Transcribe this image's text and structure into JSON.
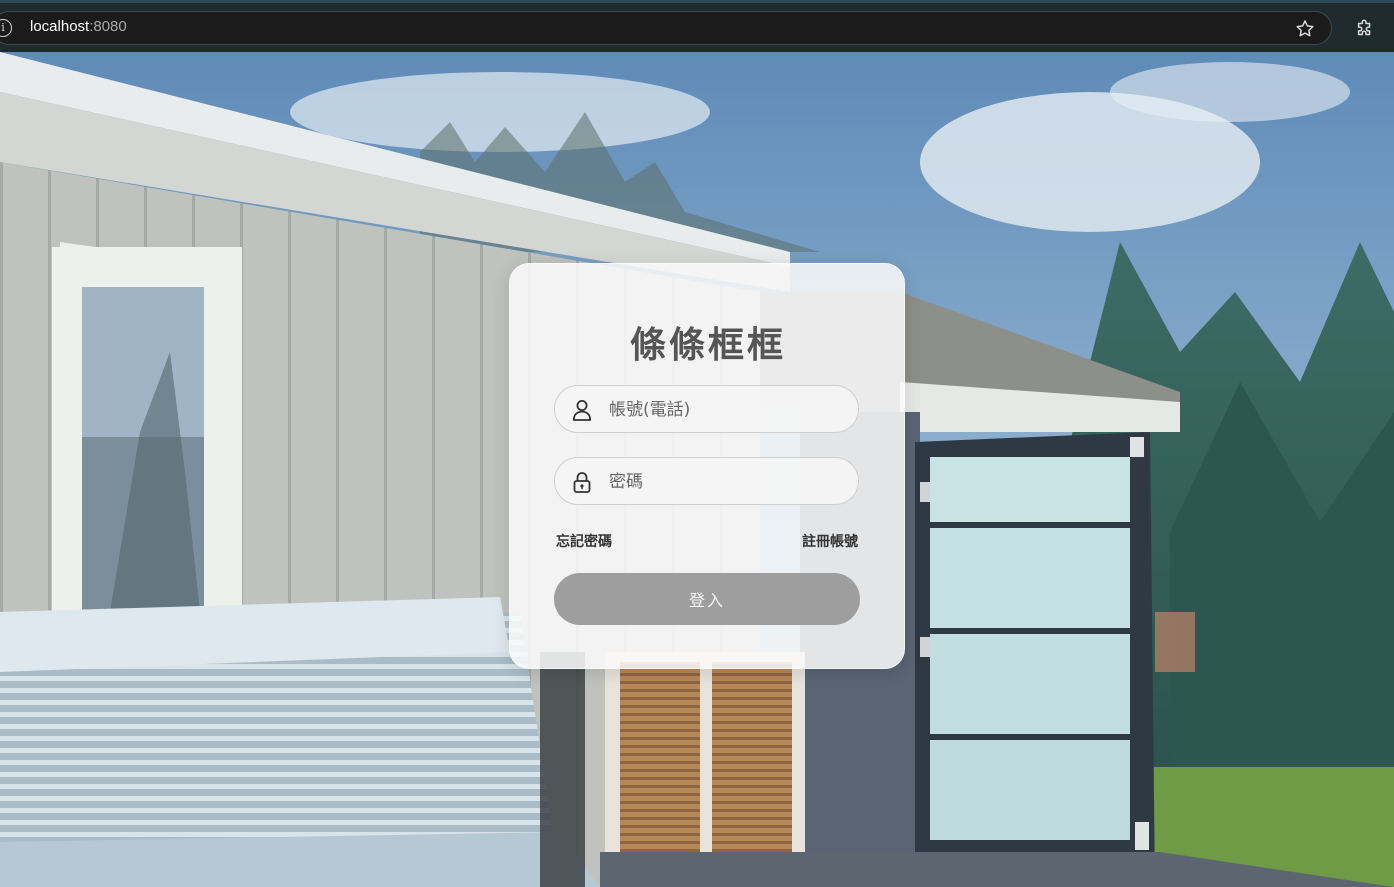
{
  "browser": {
    "url_host": "localhost",
    "url_port": ":8080",
    "icons": [
      "info-icon",
      "bookmark-star-icon",
      "extensions-puzzle-icon"
    ]
  },
  "login": {
    "title": "條條框框",
    "account_placeholder": "帳號(電話)",
    "account_value": "",
    "password_placeholder": "密碼",
    "password_value": "",
    "forgot_password": "忘記密碼",
    "register": "註冊帳號",
    "submit": "登入",
    "icons": [
      "user-icon",
      "lock-icon"
    ]
  },
  "colors": {
    "card_background": "#fafafa",
    "title_text": "#555555",
    "button_background": "#9e9e9e",
    "button_text": "#f4f4f4",
    "browser_bar": "#1f2a2e"
  }
}
